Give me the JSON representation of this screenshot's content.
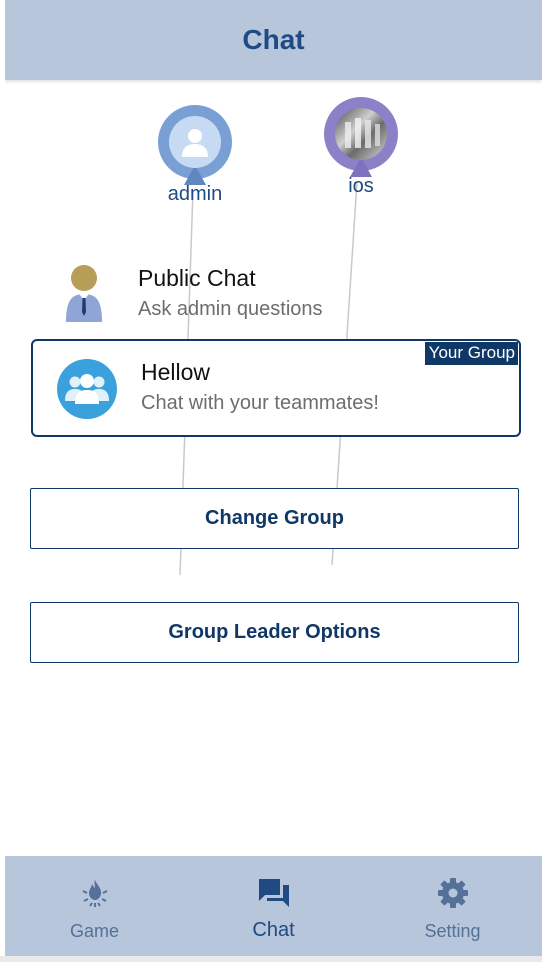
{
  "header": {
    "title": "Chat"
  },
  "markers": [
    {
      "name": "admin",
      "color": "#7a9fd4",
      "icon": "user-silhouette-icon"
    },
    {
      "name": "ios",
      "color": "#8e80c8",
      "icon": "photo-avatar"
    }
  ],
  "public_chat": {
    "title": "Public Chat",
    "subtitle": "Ask admin questions",
    "icon": "admin-person-icon"
  },
  "group": {
    "badge": "Your Group",
    "title": "Hellow",
    "subtitle": "Chat with your teammates!",
    "icon": "group-people-icon",
    "color": "#3aa1dc"
  },
  "buttons": {
    "change_group": "Change Group",
    "leader_options": "Group Leader Options"
  },
  "tabs": [
    {
      "label": "Game",
      "icon": "campfire-icon",
      "active": false
    },
    {
      "label": "Chat",
      "icon": "chat-bubbles-icon",
      "active": true
    },
    {
      "label": "Setting",
      "icon": "gear-icon",
      "active": false
    }
  ]
}
